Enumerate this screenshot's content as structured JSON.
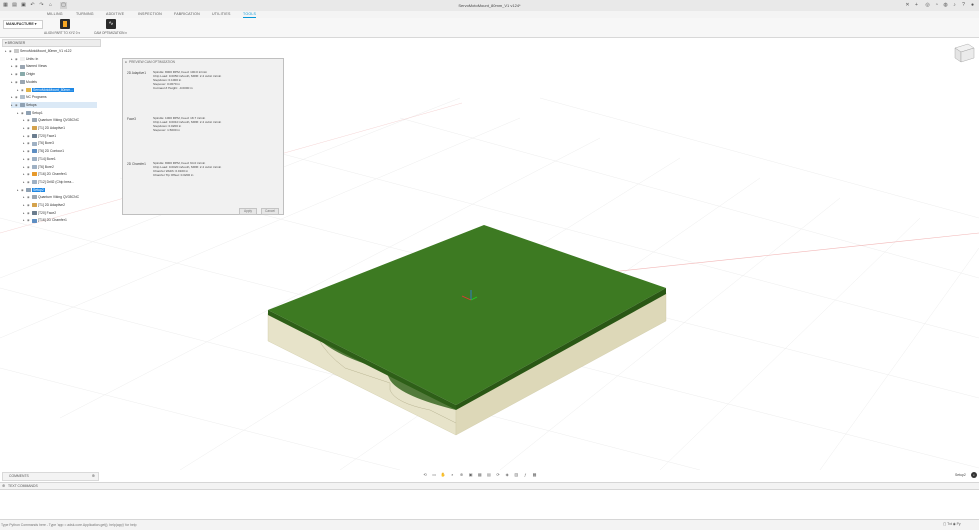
{
  "window": {
    "title": "ServoMotoMount_80mm_V1 v124*"
  },
  "ribbon": {
    "tabs": [
      "MILLING",
      "TURNING",
      "ADDITIVE",
      "INSPECTION",
      "FABRICATION",
      "UTILITIES",
      "TOOLS"
    ],
    "active_tab": "TOOLS",
    "workspace": "MANUFACTURE",
    "tools": [
      {
        "label": "ALIGN PART TO XYZ 0 ▾"
      },
      {
        "label": "CAM OPTIMIZATION ▾"
      }
    ]
  },
  "browser": {
    "header": "BROWSER",
    "items": [
      {
        "label": "ServoMotoMount_80mm_V1 v122",
        "indent": 0
      },
      {
        "label": "Units: in",
        "indent": 1
      },
      {
        "label": "Named Views",
        "indent": 1
      },
      {
        "label": "Origin",
        "indent": 1
      },
      {
        "label": "Models",
        "indent": 1
      },
      {
        "label": "ServoMotoMount_80mm...",
        "indent": 2,
        "highlight": true
      },
      {
        "label": "NC Programs",
        "indent": 1
      },
      {
        "label": "Setups",
        "indent": 1,
        "selected": true
      },
      {
        "label": "Setup1",
        "indent": 2
      },
      {
        "label": "Quantum Viking QV35CNC",
        "indent": 3
      },
      {
        "label": "[T1] 2D Adaptive1",
        "indent": 3
      },
      {
        "label": "[T20] Face1",
        "indent": 3
      },
      {
        "label": "[T6] Bore3",
        "indent": 3
      },
      {
        "label": "[T6] 2D Contour1",
        "indent": 3
      },
      {
        "label": "[T14] Bore1",
        "indent": 3
      },
      {
        "label": "[T6] Bore2",
        "indent": 3
      },
      {
        "label": "[T16] 2D Chamfer1",
        "indent": 3
      },
      {
        "label": "[T12] Drill2 (Chip brea...",
        "indent": 3
      },
      {
        "label": "Setup2",
        "indent": 2,
        "highlight": true
      },
      {
        "label": "Quantum Viking QV35CNC",
        "indent": 3
      },
      {
        "label": "[T1] 2D Adaptive2",
        "indent": 3
      },
      {
        "label": "[T20] Face2",
        "indent": 3
      },
      {
        "label": "[T16] 2D Chamfer1",
        "indent": 3
      }
    ]
  },
  "dialog": {
    "title": "PREVIEW CAM OPTIMIZATION",
    "groups": [
      {
        "name": "2D Adaptive1",
        "lines": [
          "Spindle: 8000 RPM, Feed: 100.0 in/min",
          "Chip Load: 0.0050 in/tooth, MRR: 2.4 cubic in/min",
          "Stepdown: 0.1000 in",
          "Stepover: 0.0670 in",
          "Cutmaul Z Height: -0.0000 in"
        ]
      },
      {
        "name": "Face3",
        "lines": [
          "Spindle: 1000 RPM, Feed: 18.7 in/min",
          "Chip Load: 0.0010 in/tooth, MRR: 2.4 cubic in/min",
          "Stepdown: 0.0200 in",
          "Stepover: 1.5000 in"
        ]
      },
      {
        "name": "2D Chamfer1",
        "lines": [
          "Spindle: 8000 RPM, Feed: 64.0 in/min",
          "Chip Load: 0.0020 in/tooth, MRR: 2.4 cubic in/min",
          "Chamfer Width: 0.0100 in",
          "Chamfer Tip Offset: 0.0200 in"
        ]
      }
    ],
    "apply_label": "Apply",
    "cancel_label": "Cancel"
  },
  "bottom": {
    "comments_label": "COMMENTS",
    "text_commands_label": "TEXT COMMANDS",
    "command_placeholder": "Type Python Commands here - Type 'app = adsk.core.Application.get(); help(app)' for help",
    "right_status": "Setup2"
  },
  "colors": {
    "accent": "#0696d7",
    "part_top": "#3d7a22",
    "part_side": "#e7e3c9"
  }
}
